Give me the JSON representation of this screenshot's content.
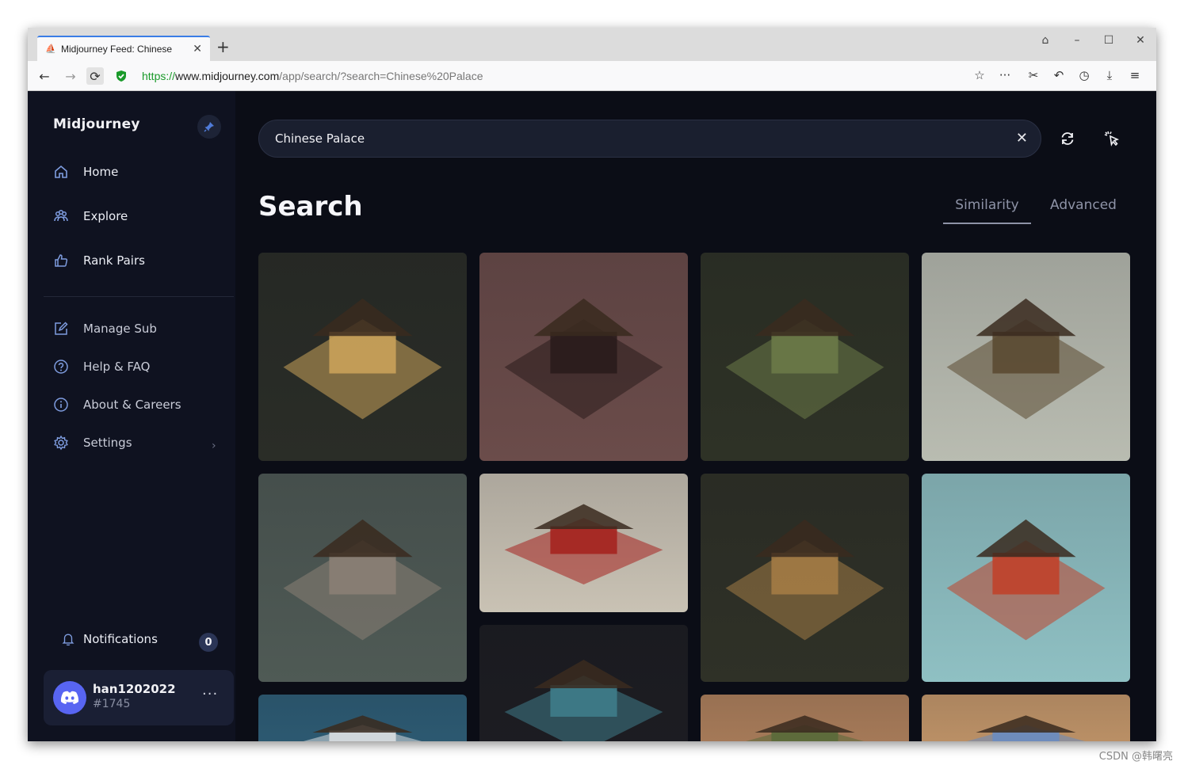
{
  "browser": {
    "tab_title": "Midjourney Feed: Chinese",
    "url_scheme": "https://",
    "url_host": "www.midjourney.com",
    "url_path": "/app/search/?search=Chinese%20Palace"
  },
  "sidebar": {
    "brand": "Midjourney",
    "primary": [
      {
        "label": "Home",
        "icon": "home-icon"
      },
      {
        "label": "Explore",
        "icon": "explore-icon"
      },
      {
        "label": "Rank Pairs",
        "icon": "thumbs-up-icon"
      }
    ],
    "secondary": [
      {
        "label": "Manage Sub",
        "icon": "edit-icon"
      },
      {
        "label": "Help & FAQ",
        "icon": "help-icon"
      },
      {
        "label": "About & Careers",
        "icon": "info-icon"
      },
      {
        "label": "Settings",
        "icon": "gear-icon"
      }
    ],
    "notifications_label": "Notifications",
    "notifications_count": "0",
    "user": {
      "name": "han1202022",
      "tag": "#1745"
    }
  },
  "search": {
    "value": "Chinese Palace"
  },
  "page": {
    "title": "Search",
    "tabs": [
      {
        "label": "Similarity",
        "active": true
      },
      {
        "label": "Advanced",
        "active": false
      }
    ]
  },
  "gallery": [
    {
      "name": "isometric-palace-garden",
      "bg": "#2a2d27",
      "accent": "#c9a25a"
    },
    {
      "name": "pagoda-sunset",
      "bg": "#6b4c4a",
      "accent": "#2a1c1c"
    },
    {
      "name": "isometric-palace-green",
      "bg": "#2e3226",
      "accent": "#6b7a48"
    },
    {
      "name": "ornate-palace-pond",
      "bg": "#b9bcb1",
      "accent": "#5b4a32"
    },
    {
      "name": "floating-island-palace",
      "bg": "#4f5a55",
      "accent": "#8a8074"
    },
    {
      "name": "red-gate-hall",
      "bg": "#c9c2b4",
      "accent": "#a5231f"
    },
    {
      "name": "isometric-courtyard",
      "bg": "#2f3127",
      "accent": "#a37b45"
    },
    {
      "name": "forbidden-city-hall",
      "bg": "#8fc0c3",
      "accent": "#c0432b"
    },
    {
      "name": "blue-pagoda-night",
      "bg": "#1d1d22",
      "accent": "#3f7c8a"
    },
    {
      "name": "sky-clouds",
      "bg": "#2f5f78",
      "accent": "#d8dde0"
    },
    {
      "name": "desert-palace",
      "bg": "#b1825d",
      "accent": "#5a6a3a"
    },
    {
      "name": "palace-dusk",
      "bg": "#c89a6c",
      "accent": "#6a8cc0"
    }
  ],
  "watermark": "CSDN @韩曙亮"
}
